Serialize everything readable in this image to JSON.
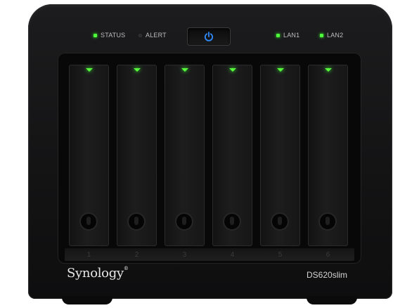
{
  "device": {
    "brand": "Synology",
    "trademark": "®",
    "model": "DS620slim"
  },
  "indicators": [
    {
      "label": "STATUS",
      "state": "on",
      "color": "#4dff3a"
    },
    {
      "label": "ALERT",
      "state": "off",
      "color": "#2b2b2b"
    },
    {
      "label": "LAN1",
      "state": "on",
      "color": "#4dff3a"
    },
    {
      "label": "LAN2",
      "state": "on",
      "color": "#4dff3a"
    }
  ],
  "power_button": {
    "icon": "power-icon",
    "color": "#2f8cff"
  },
  "bays": [
    {
      "number": "1",
      "led": "on"
    },
    {
      "number": "2",
      "led": "on"
    },
    {
      "number": "3",
      "led": "on"
    },
    {
      "number": "4",
      "led": "on"
    },
    {
      "number": "5",
      "led": "on"
    },
    {
      "number": "6",
      "led": "on"
    }
  ],
  "colors": {
    "body": "#161617",
    "led_green": "#4dff3a",
    "power_blue": "#2f8cff"
  }
}
